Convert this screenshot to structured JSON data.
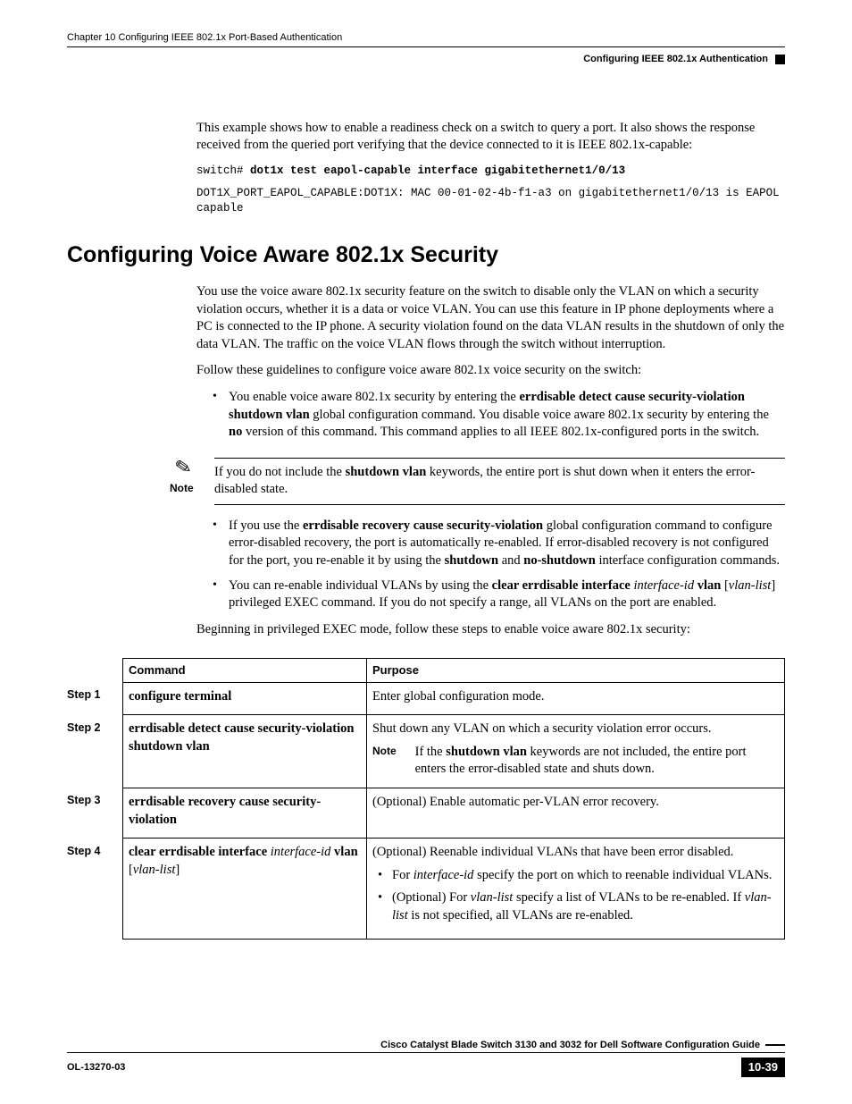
{
  "header": {
    "chapter": "Chapter 10      Configuring IEEE 802.1x Port-Based Authentication",
    "section": "Configuring IEEE 802.1x Authentication"
  },
  "intro": {
    "p1": "This example shows how to enable a readiness check on a switch to query a port. It also shows the response received from the queried port verifying that the device connected to it is IEEE 802.1x-capable:",
    "code_prompt": "switch# ",
    "code_cmd": "dot1x test eapol-capable interface gigabitethernet1/0/13",
    "code_out": "DOT1X_PORT_EAPOL_CAPABLE:DOT1X: MAC 00-01-02-4b-f1-a3 on gigabitethernet1/0/13 is EAPOL capable"
  },
  "h2": "Configuring Voice Aware 802.1x Security",
  "sec": {
    "p1": "You use the voice aware 802.1x security feature on the switch to disable only the VLAN on which a security violation occurs, whether it is a data or voice VLAN. You can use this feature in IP phone deployments where a PC is connected to the IP phone. A security violation found on the data VLAN results in the shutdown of only the data VLAN. The traffic on the voice VLAN flows through the switch without interruption.",
    "p2": "Follow these guidelines to configure voice aware 802.1x voice security on the switch:",
    "b1_pre": "You enable voice aware 802.1x security by entering the ",
    "b1_bold": "errdisable detect cause security-violation shutdown vlan",
    "b1_mid": " global configuration command. You disable voice aware 802.1x security by entering the ",
    "b1_bold2": "no",
    "b1_post": " version of this command. This command applies to all IEEE 802.1x-configured ports in the switch.",
    "note_label": "Note",
    "note_pre": "If you do not include the ",
    "note_bold": "shutdown vlan",
    "note_post": " keywords, the entire port is shut down when it enters the error-disabled state.",
    "b2_pre": "If you use the ",
    "b2_bold": "errdisable recovery cause security-violation",
    "b2_mid": " global configuration command to configure error-disabled recovery, the port is automatically re-enabled. If error-disabled recovery is not configured for the port, you re-enable it by using the ",
    "b2_bold2": "shutdown",
    "b2_and": " and ",
    "b2_bold3": "no-shutdown",
    "b2_post": " interface configuration commands.",
    "b3_pre": "You can re-enable individual VLANs by using the ",
    "b3_bold": "clear errdisable interface",
    "b3_sp": " ",
    "b3_ital": "interface-id",
    "b3_sp2": " ",
    "b3_bold2": "vlan",
    "b3_mid": " [",
    "b3_ital2": "vlan-list",
    "b3_post": "] privileged EXEC command. If you do not specify a range, all VLANs on the port are enabled.",
    "p3": "Beginning in privileged EXEC mode, follow these steps to enable voice aware 802.1x security:"
  },
  "table": {
    "h_cmd": "Command",
    "h_pur": "Purpose",
    "rows": [
      {
        "step": "Step 1",
        "cmd_b": "configure terminal",
        "purpose": "Enter global configuration mode."
      },
      {
        "step": "Step 2",
        "cmd_b": "errdisable detect cause security-violation shutdown vlan",
        "purpose_line1": "Shut down any VLAN on which a security violation error occurs.",
        "note_label": "Note",
        "note_pre": "If the ",
        "note_bold": "shutdown vlan",
        "note_post": " keywords are not included, the entire port enters the error-disabled state and shuts down."
      },
      {
        "step": "Step 3",
        "cmd_b": "errdisable recovery cause security-violation",
        "purpose": "(Optional) Enable automatic per-VLAN error recovery."
      },
      {
        "step": "Step 4",
        "cmd_b1": "clear errdisable interface",
        "cmd_i1": "interface-id",
        "cmd_b2": "vlan",
        "cmd_lb": " [",
        "cmd_i2": "vlan-list",
        "cmd_rb": "]",
        "purpose_line1": "(Optional) Reenable individual VLANs that have been error disabled.",
        "sub1_pre": "For ",
        "sub1_ital": "interface-id",
        "sub1_post": " specify the port on which to reenable individual VLANs.",
        "sub2_pre": "(Optional) For ",
        "sub2_ital": "vlan-list",
        "sub2_mid": " specify a list of VLANs to be re-enabled. If ",
        "sub2_ital2": "vlan-list",
        "sub2_post": " is not specified, all VLANs are re-enabled."
      }
    ]
  },
  "footer": {
    "title": "Cisco Catalyst Blade Switch 3130 and 3032 for Dell Software Configuration Guide",
    "docnum": "OL-13270-03",
    "pagenum": "10-39"
  }
}
